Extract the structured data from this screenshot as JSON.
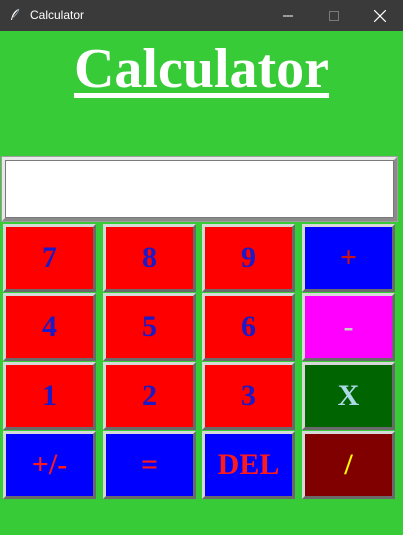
{
  "window": {
    "title": "Calculator"
  },
  "heading": "Calculator",
  "display": {
    "value": ""
  },
  "keys": [
    {
      "label": "7",
      "bg": "#ff0000",
      "fg": "#1a1ac8"
    },
    {
      "label": "8",
      "bg": "#ff0000",
      "fg": "#1a1ac8"
    },
    {
      "label": "9",
      "bg": "#ff0000",
      "fg": "#1a1ac8"
    },
    {
      "label": "+",
      "bg": "#0000ff",
      "fg": "#c81414"
    },
    {
      "label": "4",
      "bg": "#ff0000",
      "fg": "#1a1ac8"
    },
    {
      "label": "5",
      "bg": "#ff0000",
      "fg": "#1a1ac8"
    },
    {
      "label": "6",
      "bg": "#ff0000",
      "fg": "#1a1ac8"
    },
    {
      "label": "-",
      "bg": "#ff00ff",
      "fg": "#c8c8c8"
    },
    {
      "label": "1",
      "bg": "#ff0000",
      "fg": "#1a1ac8"
    },
    {
      "label": "2",
      "bg": "#ff0000",
      "fg": "#1a1ac8"
    },
    {
      "label": "3",
      "bg": "#ff0000",
      "fg": "#1a1ac8"
    },
    {
      "label": "X",
      "bg": "#006400",
      "fg": "#add8e6"
    },
    {
      "label": "+/-",
      "bg": "#0000ff",
      "fg": "#ff1a1a"
    },
    {
      "label": "=",
      "bg": "#0000ff",
      "fg": "#ff1a1a"
    },
    {
      "label": "DEL",
      "bg": "#0000ff",
      "fg": "#ff1a1a"
    },
    {
      "label": "/",
      "bg": "#800000",
      "fg": "#ffff00"
    }
  ],
  "colors": {
    "background": "#37cc37",
    "titlebar": "#3a3a3a"
  }
}
